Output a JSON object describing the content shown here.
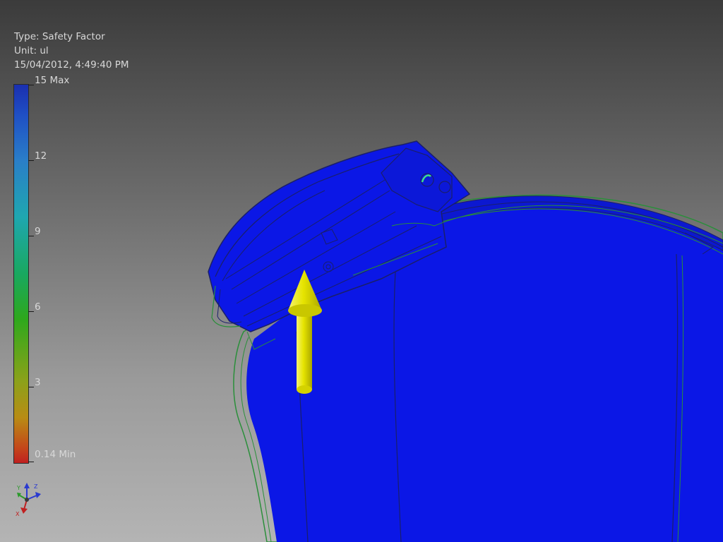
{
  "info": {
    "type_line": "Type: Safety Factor",
    "unit_line": "Unit: ul",
    "date_line": "15/04/2012, 4:49:40 PM"
  },
  "legend": {
    "labels": [
      "15 Max",
      "12",
      "9",
      "6",
      "3",
      "0.14 Min"
    ],
    "max": 15,
    "min": 0.14
  },
  "triad": {
    "y_label": "Y",
    "z_label": "Z",
    "x_label": "X"
  },
  "colors": {
    "model_fill": "#0b17e6",
    "edge": "#2a8f3a",
    "load_arrow": "#e8e600"
  },
  "icons": {
    "load_arrow": "load-arrow-icon",
    "triad": "view-triad-icon"
  }
}
